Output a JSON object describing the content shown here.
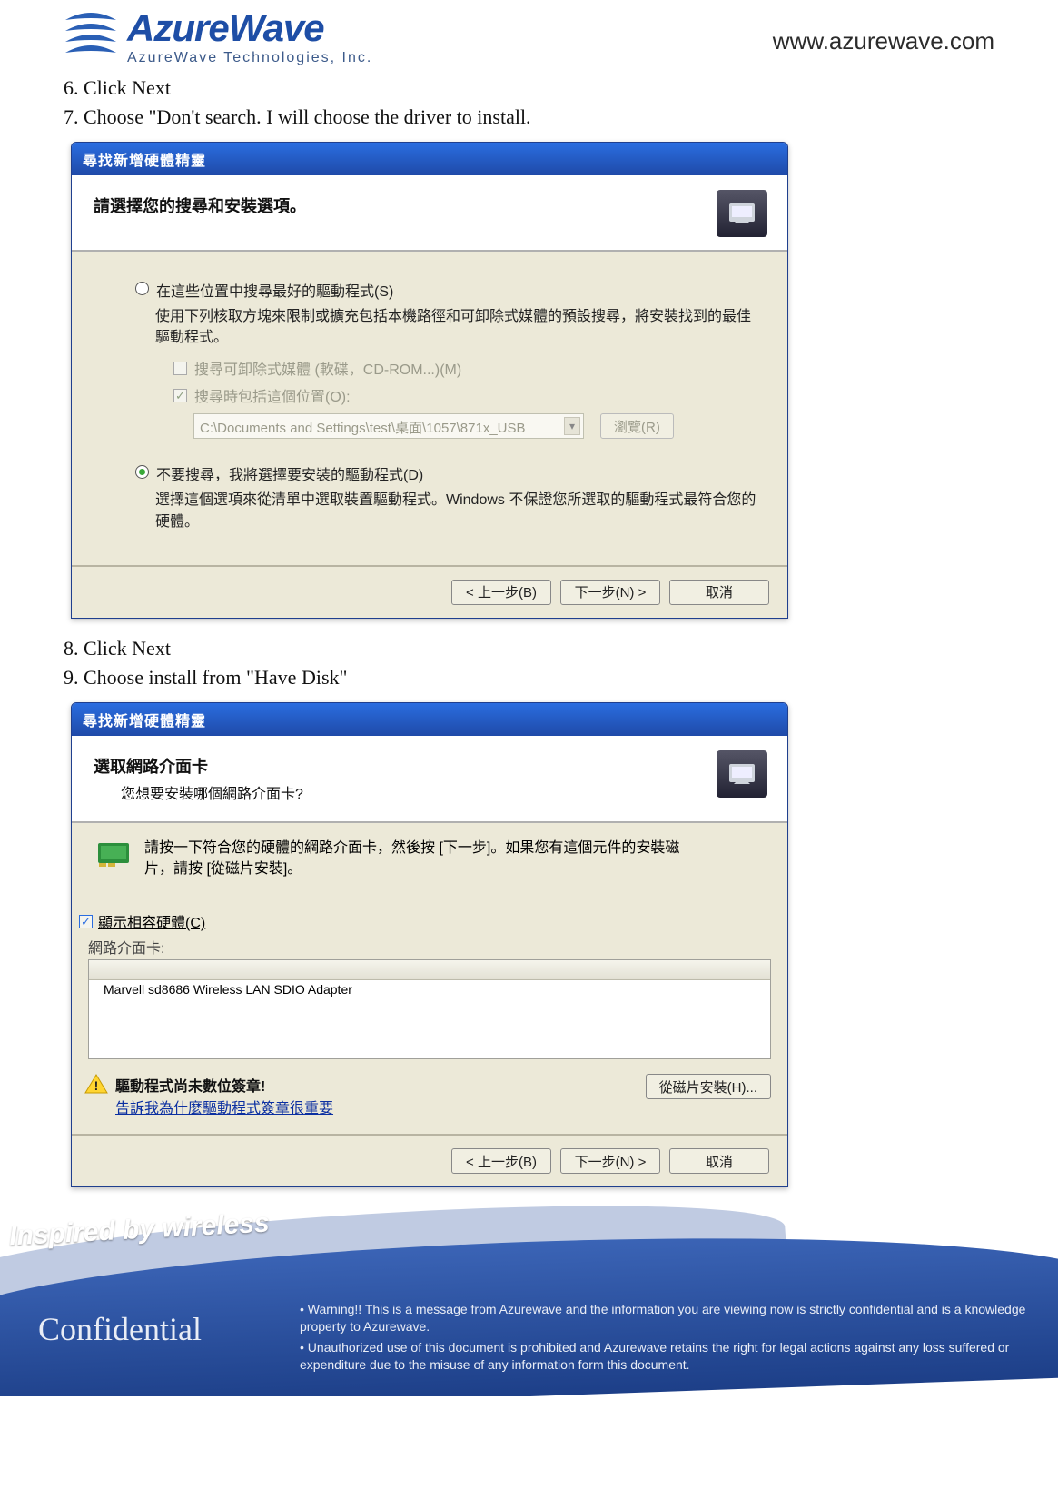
{
  "header": {
    "logo_main": "AzureWave",
    "logo_sub": "AzureWave  Technologies,  Inc.",
    "site_url": "www.azurewave.com"
  },
  "steps": {
    "s6": "6. Click Next",
    "s7": "7. Choose \"Don't search. I will choose the driver to install.",
    "s8": "8. Click Next",
    "s9": "9. Choose install from \"Have Disk\""
  },
  "dlg1": {
    "title": "尋找新增硬體精靈",
    "head": "請選擇您的搜尋和安裝選項。",
    "r1_label": "在這些位置中搜尋最好的驅動程式(S)",
    "r1_desc": "使用下列核取方塊來限制或擴充包括本機路徑和可卸除式媒體的預設搜尋，將安裝找到的最佳驅動程式。",
    "chk1": "搜尋可卸除式媒體 (軟碟，CD-ROM...)(M)",
    "chk2": "搜尋時包括這個位置(O):",
    "path": "C:\\Documents and Settings\\test\\桌面\\1057\\871x_USB",
    "browse": "瀏覽(R)",
    "r2_label": "不要搜尋，我將選擇要安裝的驅動程式(D)",
    "r2_desc": "選擇這個選項來從清單中選取裝置驅動程式。Windows 不保證您所選取的驅動程式最符合您的硬體。",
    "back": "< 上一步(B)",
    "next": "下一步(N) >",
    "cancel": "取消"
  },
  "dlg2": {
    "title": "尋找新增硬體精靈",
    "head": "選取網路介面卡",
    "head_sub": "您想要安裝哪個網路介面卡?",
    "instruct": "請按一下符合您的硬體的網路介面卡，然後按 [下一步]。如果您有這個元件的安裝磁片，請按 [從磁片安裝]。",
    "compat": "顯示相容硬體(C)",
    "list_label": "網路介面卡:",
    "list_item": "Marvell sd8686 Wireless LAN SDIO Adapter",
    "warn_title": "驅動程式尚未數位簽章!",
    "warn_link": "告訴我為什麼驅動程式簽章很重要",
    "have_disk": "從磁片安裝(H)...",
    "back": "< 上一步(B)",
    "next": "下一步(N) >",
    "cancel": "取消"
  },
  "footer": {
    "inspired": "Inspired by wireless",
    "confidential": "Confidential",
    "d1": "• Warning!! This is a message from Azurewave and the information you are viewing now is strictly confidential and is a knowledge property to Azurewave.",
    "d2": "• Unauthorized use of this document is prohibited and Azurewave retains the right for legal actions against any loss suffered or expenditure due to the misuse of any information form this document."
  }
}
